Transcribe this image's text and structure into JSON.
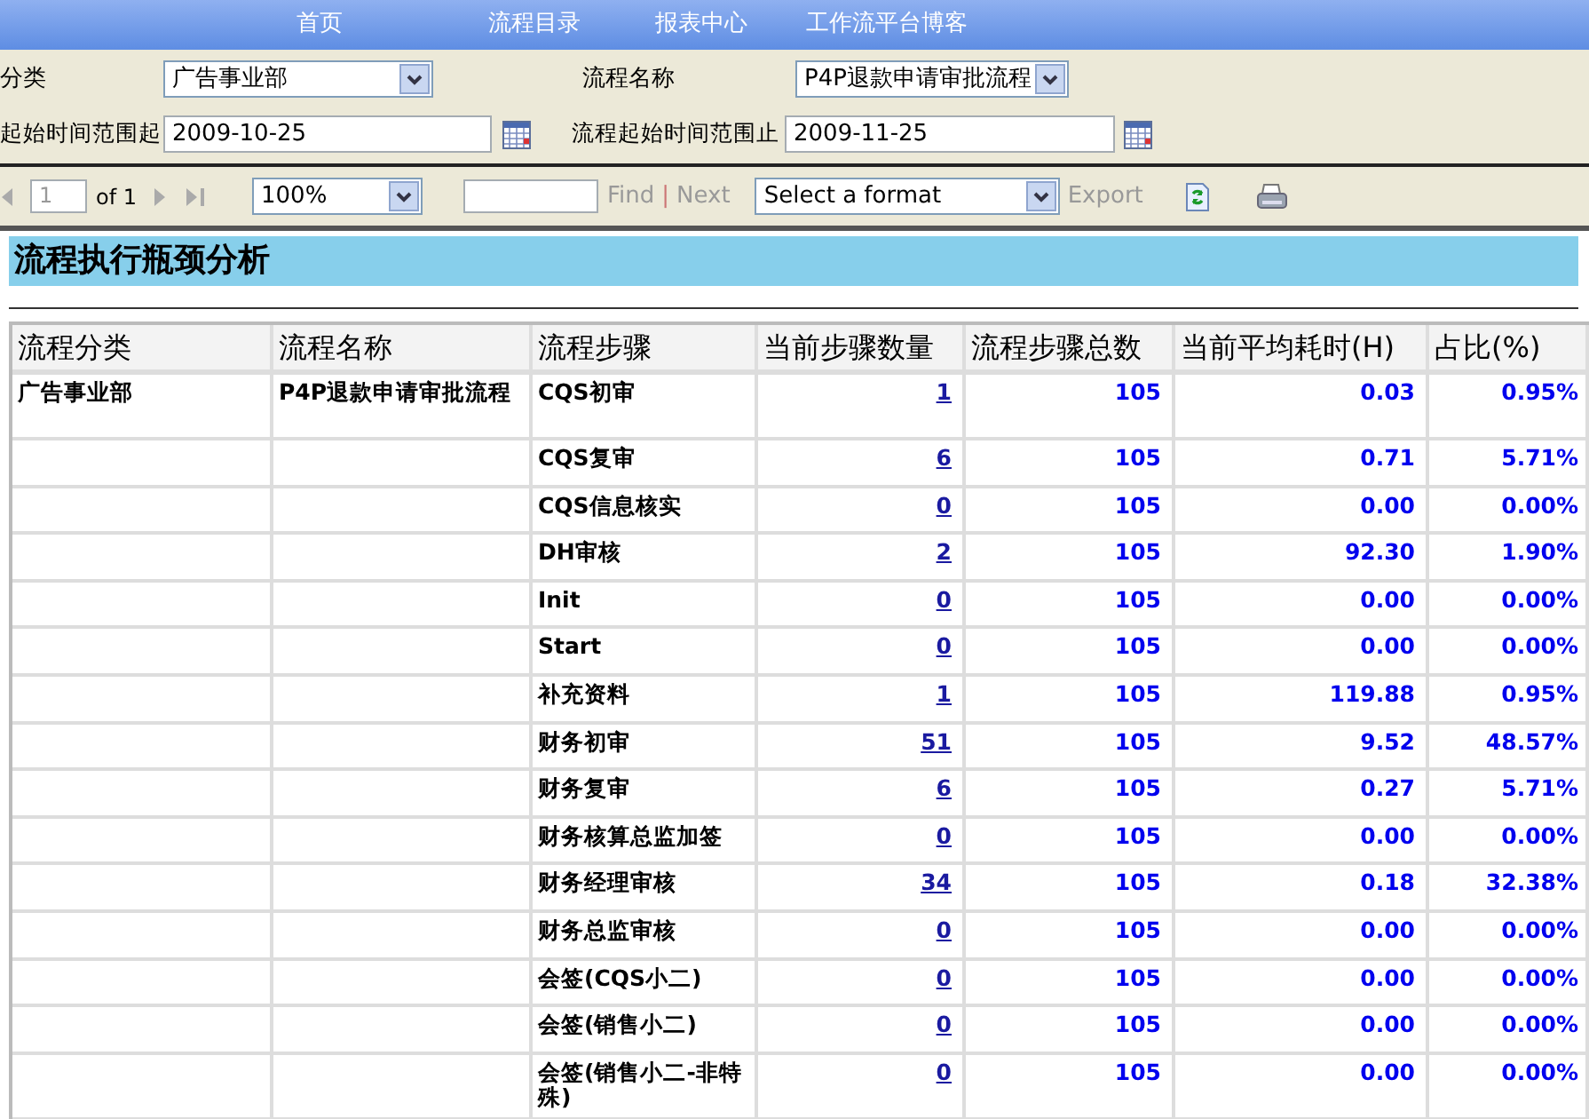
{
  "nav": [
    {
      "label": "首页"
    },
    {
      "label": "流程目录"
    },
    {
      "label": "报表中心"
    },
    {
      "label": "工作流平台博客"
    }
  ],
  "filters": {
    "category_label": "分类",
    "category_value": "广告事业部",
    "process_label": "流程名称",
    "process_value": "P4P退款申请审批流程",
    "start_label": "起始时间范围起",
    "start_value": "2009-10-25",
    "end_label": "流程起始时间范围止",
    "end_value": "2009-11-25"
  },
  "toolbar": {
    "page": "1",
    "of_pages": "of 1",
    "zoom": "100%",
    "find": "Find",
    "separator": "|",
    "next": "Next",
    "format": "Select a format",
    "export": "Export"
  },
  "report": {
    "title": "流程执行瓶颈分析",
    "columns": [
      "流程分类",
      "流程名称",
      "流程步骤",
      "当前步骤数量",
      "流程步骤总数",
      "当前平均耗时(H)",
      "占比(%)"
    ],
    "rows": [
      {
        "category": "广告事业部",
        "process": "P4P退款申请审批流程",
        "step": "CQS初审",
        "count": "1",
        "total": "105",
        "avg": "0.03",
        "ratio": "0.95%"
      },
      {
        "step": "CQS复审",
        "count": "6",
        "total": "105",
        "avg": "0.71",
        "ratio": "5.71%"
      },
      {
        "step": "CQS信息核实",
        "count": "0",
        "total": "105",
        "avg": "0.00",
        "ratio": "0.00%"
      },
      {
        "step": "DH审核",
        "count": "2",
        "total": "105",
        "avg": "92.30",
        "ratio": "1.90%"
      },
      {
        "step": "Init",
        "count": "0",
        "total": "105",
        "avg": "0.00",
        "ratio": "0.00%"
      },
      {
        "step": "Start",
        "count": "0",
        "total": "105",
        "avg": "0.00",
        "ratio": "0.00%"
      },
      {
        "step": "补充资料",
        "count": "1",
        "total": "105",
        "avg": "119.88",
        "ratio": "0.95%"
      },
      {
        "step": "财务初审",
        "count": "51",
        "total": "105",
        "avg": "9.52",
        "ratio": "48.57%"
      },
      {
        "step": "财务复审",
        "count": "6",
        "total": "105",
        "avg": "0.27",
        "ratio": "5.71%"
      },
      {
        "step": "财务核算总监加签",
        "count": "0",
        "total": "105",
        "avg": "0.00",
        "ratio": "0.00%"
      },
      {
        "step": "财务经理审核",
        "count": "34",
        "total": "105",
        "avg": "0.18",
        "ratio": "32.38%"
      },
      {
        "step": "财务总监审核",
        "count": "0",
        "total": "105",
        "avg": "0.00",
        "ratio": "0.00%"
      },
      {
        "step": "会签(CQS小二)",
        "count": "0",
        "total": "105",
        "avg": "0.00",
        "ratio": "0.00%"
      },
      {
        "step": "会签(销售小二)",
        "count": "0",
        "total": "105",
        "avg": "0.00",
        "ratio": "0.00%"
      },
      {
        "step": "会签(销售小二-非特殊)",
        "count": "0",
        "total": "105",
        "avg": "0.00",
        "ratio": "0.00%"
      }
    ]
  }
}
